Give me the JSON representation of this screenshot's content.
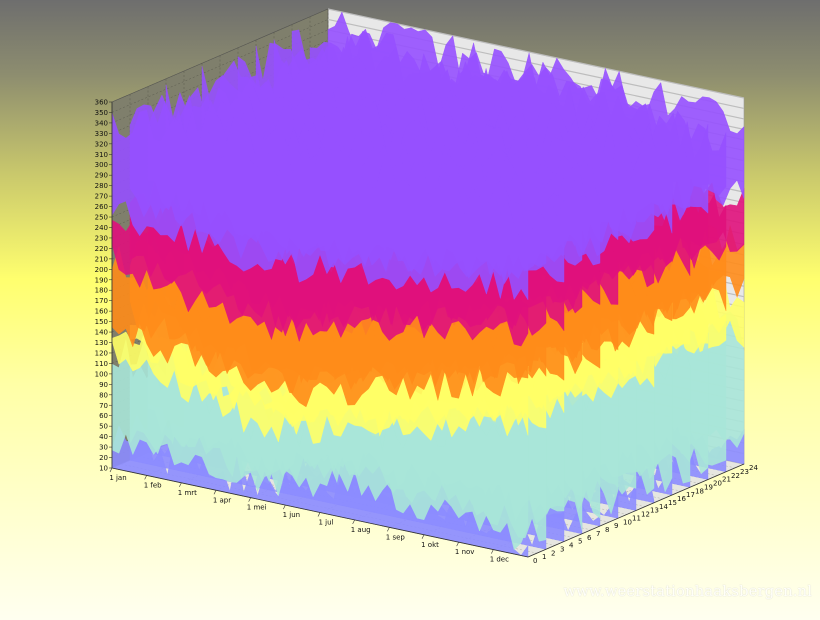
{
  "chart_data": {
    "type": "area",
    "title": "",
    "xlabel": "",
    "ylabel": "",
    "zlabel": "",
    "ylim": [
      10,
      360
    ],
    "y_ticks": [
      10,
      20,
      30,
      40,
      50,
      60,
      70,
      80,
      90,
      100,
      110,
      120,
      130,
      140,
      150,
      160,
      170,
      180,
      190,
      200,
      210,
      220,
      230,
      240,
      250,
      260,
      270,
      280,
      290,
      300,
      310,
      320,
      330,
      340,
      350,
      360
    ],
    "x_ticks": [
      "1 jan",
      "1 feb",
      "1 mrt",
      "1 apr",
      "1 mei",
      "1 jun",
      "1 jul",
      "1 aug",
      "1 sep",
      "1 okt",
      "1 nov",
      "1 dec"
    ],
    "z_ticks": [
      "0",
      "1",
      "2",
      "3",
      "4",
      "5",
      "6",
      "7",
      "8",
      "9",
      "10",
      "11",
      "12",
      "13",
      "14",
      "15",
      "16",
      "17",
      "18",
      "19",
      "20",
      "21",
      "22",
      "23",
      "24"
    ],
    "bands": [
      {
        "name": "",
        "color": "#8c8cff",
        "values": [
          40,
          30,
          35,
          25,
          30,
          35,
          45,
          40,
          35,
          40,
          30,
          25
        ]
      },
      {
        "name": "",
        "color": "#a8e6d8",
        "values": [
          120,
          110,
          100,
          90,
          80,
          85,
          95,
          100,
          110,
          120,
          130,
          135
        ]
      },
      {
        "name": "",
        "color": "#ffff66",
        "values": [
          150,
          140,
          130,
          120,
          115,
          120,
          130,
          140,
          150,
          160,
          170,
          175
        ]
      },
      {
        "name": "",
        "color": "#ff8c1a",
        "values": [
          210,
          200,
          190,
          180,
          175,
          180,
          190,
          200,
          205,
          215,
          220,
          225
        ]
      },
      {
        "name": "",
        "color": "#e0117c",
        "values": [
          260,
          250,
          245,
          240,
          235,
          240,
          245,
          250,
          255,
          260,
          265,
          270
        ]
      },
      {
        "name": "",
        "color": "#9650ff",
        "values": [
          340,
          345,
          350,
          345,
          340,
          345,
          350,
          350,
          345,
          340,
          335,
          330
        ]
      }
    ],
    "grid": true,
    "legend": "none"
  },
  "watermark": "www.weerstationhaaksbergen.nl"
}
